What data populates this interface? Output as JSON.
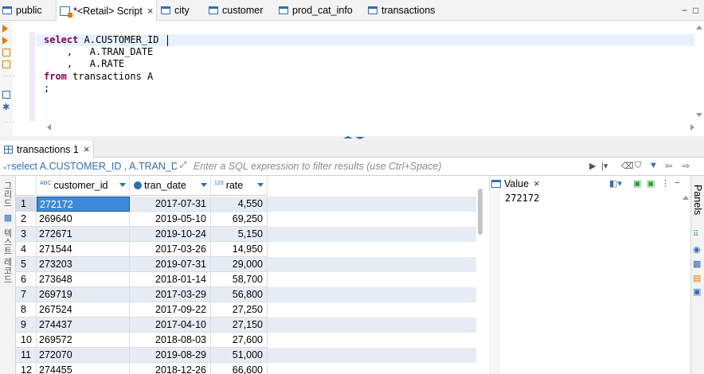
{
  "editor_tabs": [
    {
      "label": "public"
    },
    {
      "label": "*<Retail> Script",
      "close": "×"
    },
    {
      "label": "city"
    },
    {
      "label": "customer"
    },
    {
      "label": "prod_cat_info"
    },
    {
      "label": "transactions"
    }
  ],
  "window_controls": {
    "minimize": "−",
    "maximize": "□"
  },
  "sql": {
    "line1_kw": "select",
    "line1_rest": " A.CUSTOMER_ID ",
    "line2": "    ,   A.TRAN_DATE",
    "line3": "    ,   A.RATE",
    "line4_kw": "from",
    "line4_rest": " transactions A",
    "line5": ";"
  },
  "results_tab": {
    "label": "transactions 1",
    "close": "×"
  },
  "filter": {
    "query_text": "select A.CUSTOMER_ID , A.TRAN_DA",
    "type_marker": "«T",
    "placeholder": "Enter a SQL expression to filter results (use Ctrl+Space)"
  },
  "side_tabs": [
    "그리드",
    "텍스트",
    "레코드"
  ],
  "grid": {
    "columns": [
      {
        "label": "customer_id",
        "type": "ABC"
      },
      {
        "label": "tran_date",
        "type": "clock"
      },
      {
        "label": "rate",
        "type": "123"
      }
    ],
    "rows": [
      {
        "n": "1",
        "customer_id": "272172",
        "tran_date": "2017-07-31",
        "rate": "4,550"
      },
      {
        "n": "2",
        "customer_id": "269640",
        "tran_date": "2019-05-10",
        "rate": "69,250"
      },
      {
        "n": "3",
        "customer_id": "272671",
        "tran_date": "2019-10-24",
        "rate": "5,150"
      },
      {
        "n": "4",
        "customer_id": "271544",
        "tran_date": "2017-03-26",
        "rate": "14,950"
      },
      {
        "n": "5",
        "customer_id": "273203",
        "tran_date": "2019-07-31",
        "rate": "29,000"
      },
      {
        "n": "6",
        "customer_id": "273648",
        "tran_date": "2018-01-14",
        "rate": "58,700"
      },
      {
        "n": "7",
        "customer_id": "269719",
        "tran_date": "2017-03-29",
        "rate": "56,800"
      },
      {
        "n": "8",
        "customer_id": "267524",
        "tran_date": "2017-09-22",
        "rate": "27,250"
      },
      {
        "n": "9",
        "customer_id": "274437",
        "tran_date": "2017-04-10",
        "rate": "27,150"
      },
      {
        "n": "10",
        "customer_id": "269572",
        "tran_date": "2018-08-03",
        "rate": "27,600"
      },
      {
        "n": "11",
        "customer_id": "272070",
        "tran_date": "2019-08-29",
        "rate": "51,000"
      },
      {
        "n": "12",
        "customer_id": "274455",
        "tran_date": "2018-12-26",
        "rate": "66,600"
      }
    ]
  },
  "value_panel": {
    "tab_label": "Value",
    "close": "×",
    "value": "272172"
  },
  "right_strip": {
    "label": "Panels"
  },
  "colors": {
    "accent": "#2f6db5",
    "selection": "#3d8ad8",
    "keyword": "#7f0055",
    "row_alt": "#e7ecf4"
  }
}
